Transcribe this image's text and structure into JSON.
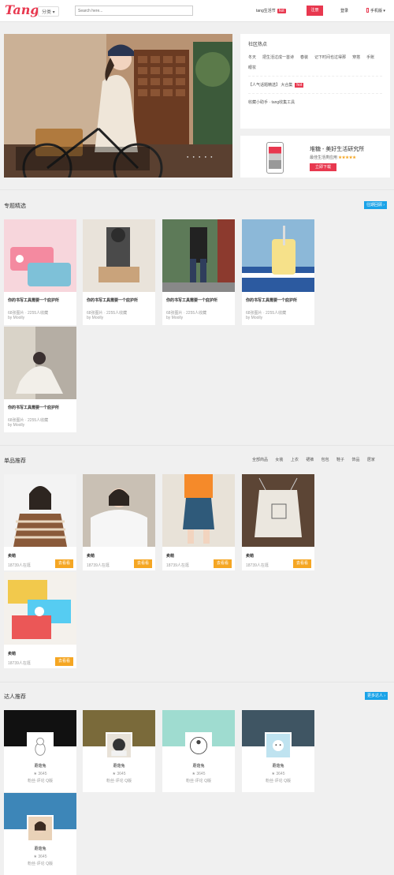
{
  "header": {
    "logo": "Tang",
    "category": "分类 ▾",
    "search_placeholder": "Search here...",
    "topic": "tang生活节",
    "topic_badge": "hot",
    "register": "注册",
    "login": "登录",
    "mobile": "手机版 ▾"
  },
  "sidebar": {
    "title": "社区热点",
    "hot_links": [
      "冬天",
      "把生活过成一首诗",
      "春装",
      "记下时间也过得那",
      "穿搭",
      "手账",
      "眼妆"
    ],
    "promo": "【人气话题精选】 大合集",
    "promo_badge": "hot",
    "tools": "收藏小助手  ·  tang收集工具"
  },
  "app": {
    "title": "堆糖 - 美好生活研究所",
    "subtitle": "最佳生活类应用",
    "stars": "★★★★★",
    "download": "立即下载"
  },
  "hero": {
    "dots": "● ● ● ● ●"
  },
  "sections": {
    "featured": {
      "title": "专题精选",
      "button": "往期回顾 ›"
    },
    "products": {
      "title": "单品推荐",
      "sorts": [
        "全部商品",
        "女装",
        "上衣",
        "裙裤",
        "包包",
        "鞋子",
        "饰品",
        "居家"
      ]
    },
    "experts": {
      "title": "达人推荐",
      "button": "更多达人 ›"
    }
  },
  "featured": [
    {
      "title": "你的书写工具需要一个庇护所",
      "meta": "68张图片 · 2255人收藏",
      "by": "by Moolly"
    },
    {
      "title": "你的书写工具需要一个庇护所",
      "meta": "68张图片 · 2255人收藏",
      "by": "by Moolly"
    },
    {
      "title": "你的书写工具需要一个庇护所",
      "meta": "68张图片 · 2255人收藏",
      "by": "by Moolly"
    },
    {
      "title": "你的书写工具需要一个庇护所",
      "meta": "68张图片 · 2255人收藏",
      "by": "by Moolly"
    },
    {
      "title": "你的书写工具需要一个庇护所",
      "meta": "68张图片 · 2255人收藏",
      "by": "by Moolly"
    }
  ],
  "products": [
    {
      "name": "卖萌",
      "wants": "18739人在逛",
      "go": "去看看"
    },
    {
      "name": "卖萌",
      "wants": "18739人在逛",
      "go": "去看看"
    },
    {
      "name": "卖萌",
      "wants": "18739人在逛",
      "go": "去看看"
    },
    {
      "name": "卖萌",
      "wants": "18739人在逛",
      "go": "去看看"
    },
    {
      "name": "卖萌",
      "wants": "18739人在逛",
      "go": "去看看"
    }
  ],
  "experts": [
    {
      "name": "蘑菇兔",
      "stat": "★ 3645",
      "tags": "粉丝·评论 Q版"
    },
    {
      "name": "蘑菇兔",
      "stat": "★ 3645",
      "tags": "粉丝·评论 Q版"
    },
    {
      "name": "蘑菇兔",
      "stat": "★ 3645",
      "tags": "粉丝·评论 Q版"
    },
    {
      "name": "蘑菇兔",
      "stat": "★ 3645",
      "tags": "粉丝·评论 Q版"
    },
    {
      "name": "蘑菇兔",
      "stat": "★ 3645",
      "tags": "粉丝·评论 Q版"
    }
  ],
  "colors": {
    "accent": "#e8384f",
    "blue": "#1aa3e8",
    "orange": "#f5a623"
  }
}
